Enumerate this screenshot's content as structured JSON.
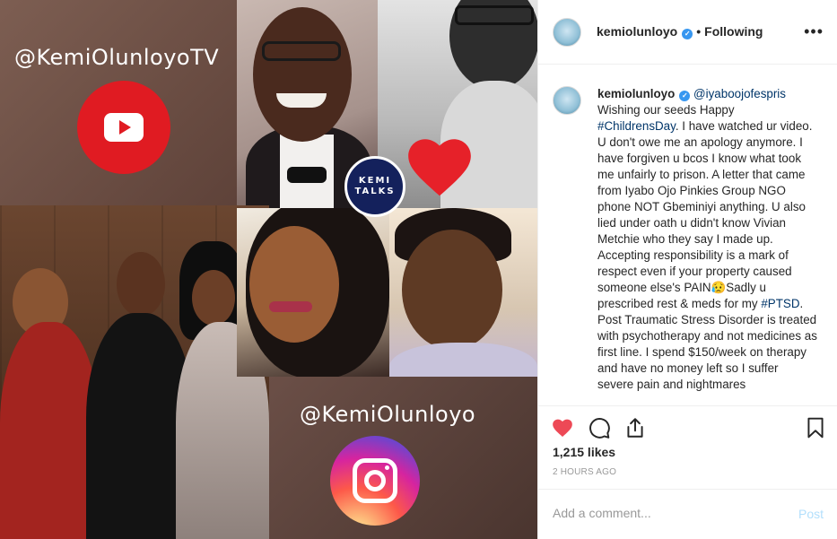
{
  "post_image": {
    "youtube_handle": "@KemiOlunloyoTV",
    "instagram_handle": "@KemiOlunloyo",
    "badge_line1": "KEMI",
    "badge_line2": "TALKS"
  },
  "header": {
    "username": "kemiolunloyo",
    "verified": true,
    "separator": "•",
    "follow_status": "Following",
    "more_icon": "more-horizontal-icon"
  },
  "caption": {
    "username": "kemiolunloyo",
    "mention": "@iyaboojofespris",
    "text_1": "Wishing our seeds Happy ",
    "hashtag_1": "#ChildrensDay",
    "text_2": ". I have watched ur video. U don't owe me an apology anymore. I have forgiven u bcos I know what took me unfairly to prison. A letter that came from Iyabo Ojo Pinkies Group NGO phone NOT Gbeminiyi anything. U also lied under oath u didn't know Vivian Metchie who they say I made up. Accepting responsibility is a mark of respect even if your property caused someone else's PAIN😥Sadly u prescribed rest & meds for my ",
    "hashtag_2": "#PTSD",
    "text_3": ". Post Traumatic Stress Disorder is treated with psychotherapy and not medicines as first line. I spend $150/week on therapy and have no money left so I suffer severe pain and nightmares"
  },
  "actions": {
    "like_icon": "heart-filled-icon",
    "comment_icon": "comment-icon",
    "share_icon": "share-icon",
    "save_icon": "bookmark-icon",
    "like_color": "#ed4956"
  },
  "stats": {
    "likes": "1,215 likes",
    "time": "2 HOURS AGO"
  },
  "comment_box": {
    "placeholder": "Add a comment...",
    "post_label": "Post"
  },
  "colors": {
    "link": "#003569",
    "verified": "#3897f0",
    "youtube_red": "#e01b22",
    "badge_navy": "#14215c"
  }
}
